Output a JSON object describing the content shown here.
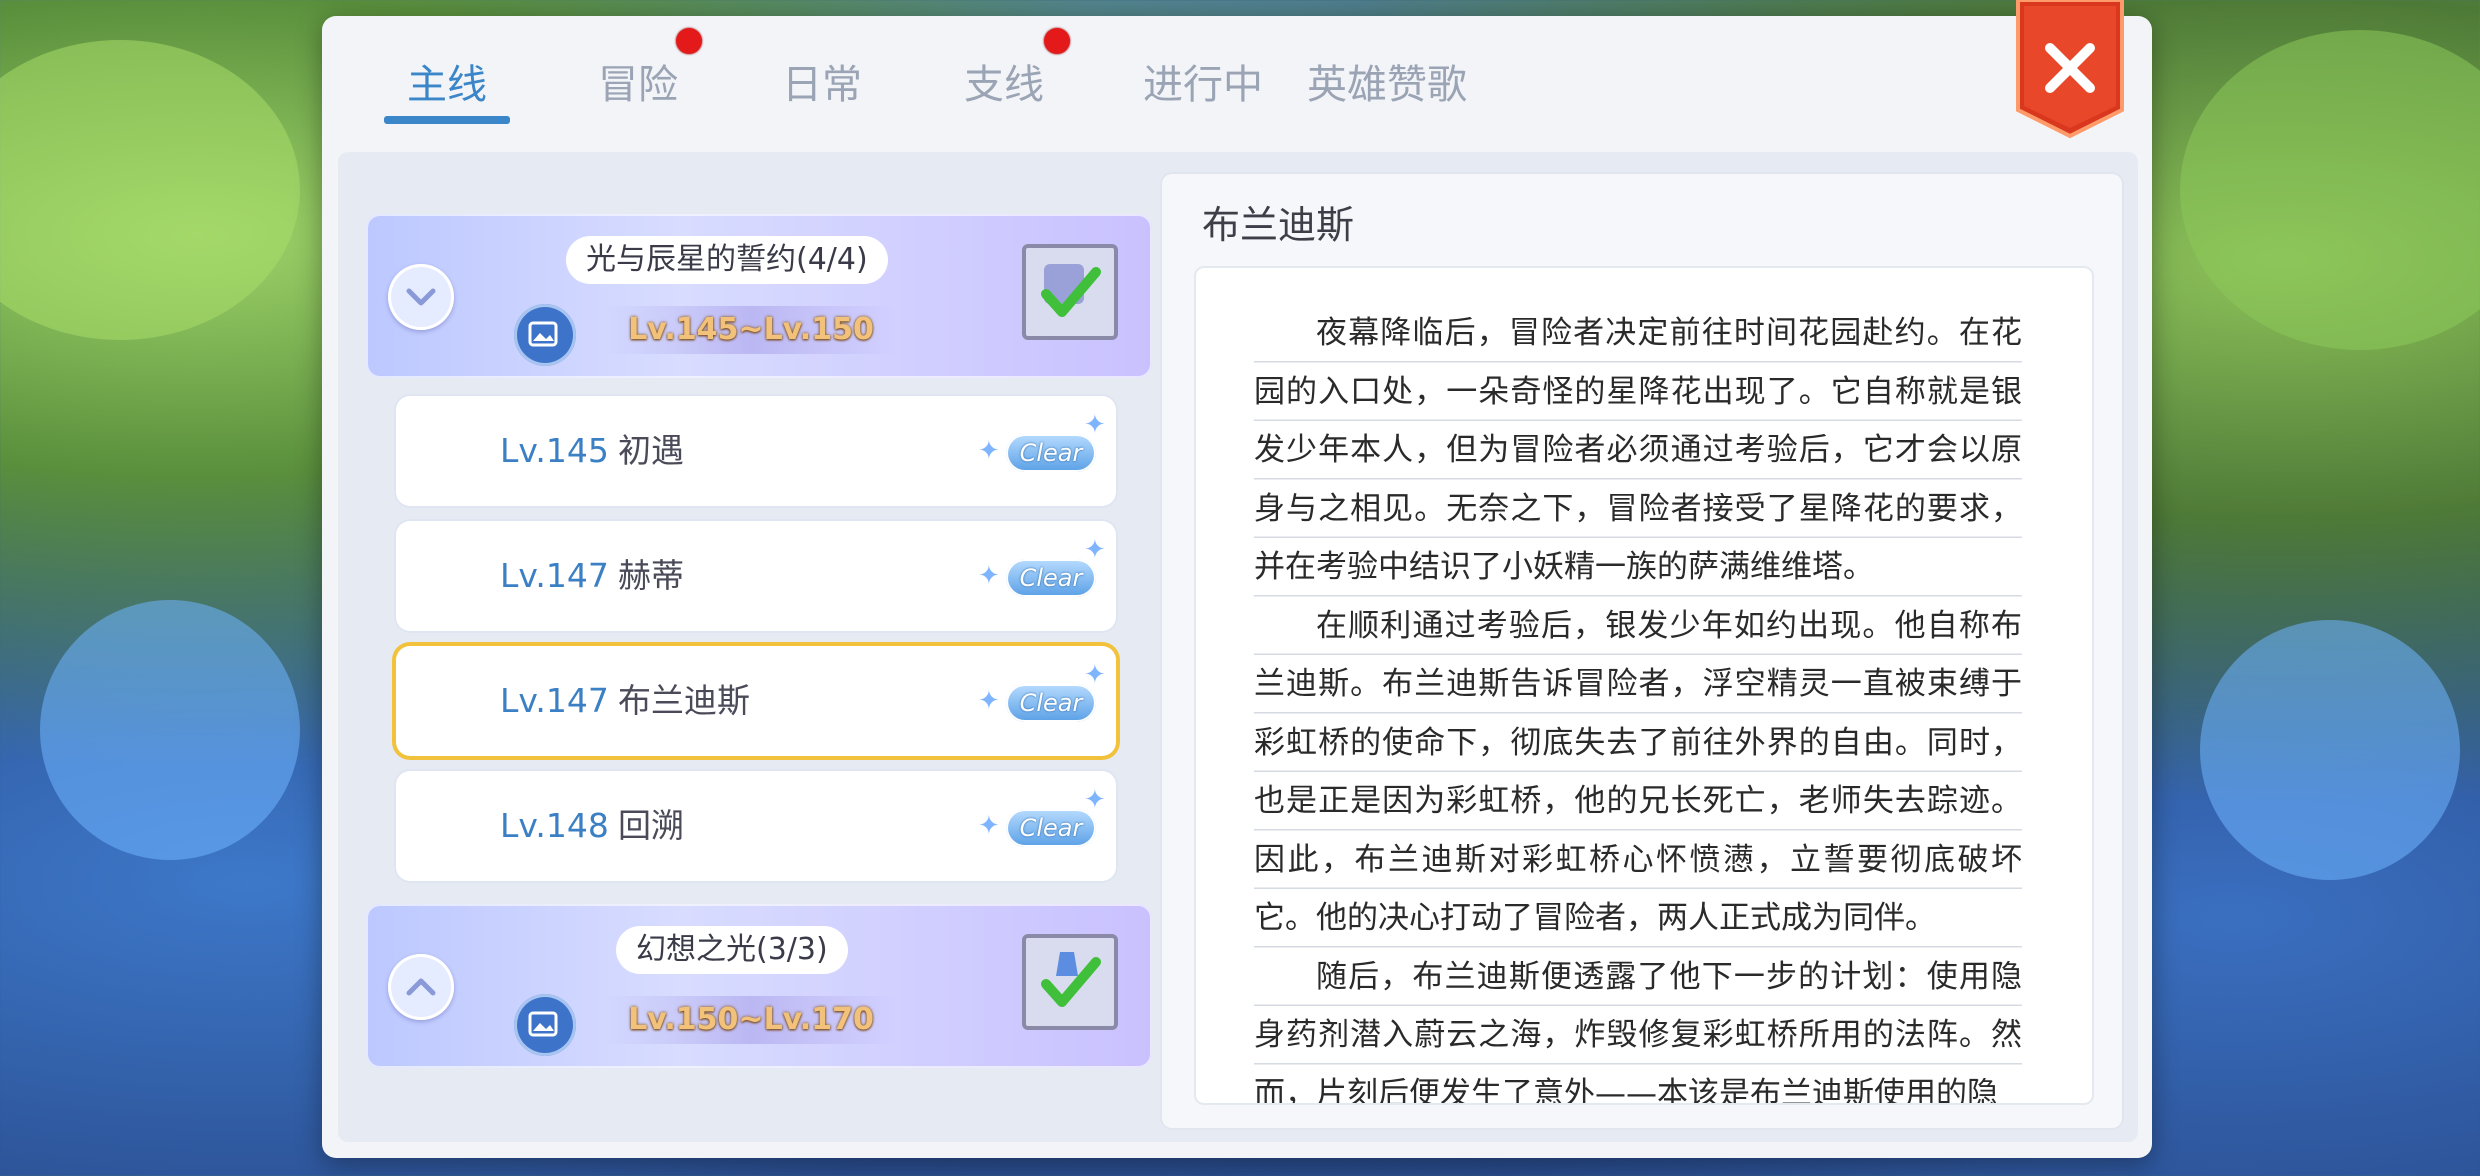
{
  "tabs": [
    {
      "label": "主线",
      "active": true,
      "dot": false
    },
    {
      "label": "冒险",
      "active": false,
      "dot": true
    },
    {
      "label": "日常",
      "active": false,
      "dot": false
    },
    {
      "label": "支线",
      "active": false,
      "dot": true
    },
    {
      "label": "进行中",
      "active": false,
      "dot": false
    },
    {
      "label": "英雄赞歌",
      "active": false,
      "dot": false
    }
  ],
  "close_icon": "close-x-icon",
  "groups": [
    {
      "title": "光与辰星的誓约(4/4)",
      "range": "Lv.145~Lv.150",
      "expanded": true
    },
    {
      "title": "幻想之光(3/3)",
      "range": "Lv.150~Lv.170",
      "expanded": false
    }
  ],
  "quests": [
    {
      "lv": "Lv.145",
      "name": "初遇",
      "badge": "Clear",
      "selected": false
    },
    {
      "lv": "Lv.147",
      "name": "赫蒂",
      "badge": "Clear",
      "selected": false
    },
    {
      "lv": "Lv.147",
      "name": "布兰迪斯",
      "badge": "Clear",
      "selected": true
    },
    {
      "lv": "Lv.148",
      "name": "回溯",
      "badge": "Clear",
      "selected": false
    }
  ],
  "detail": {
    "title": "布兰迪斯",
    "paragraphs": [
      "夜幕降临后，冒险者决定前往时间花园赴约。在花园的入口处，一朵奇怪的星降花出现了。它自称就是银发少年本人，但为冒险者必须通过考验后，它才会以原身与之相见。无奈之下，冒险者接受了星降花的要求，并在考验中结识了小妖精一族的萨满维维塔。",
      "在顺利通过考验后，银发少年如约出现。他自称布兰迪斯。布兰迪斯告诉冒险者，浮空精灵一直被束缚于彩虹桥的使命下，彻底失去了前往外界的自由。同时，也是正是因为彩虹桥，他的兄长死亡，老师失去踪迹。因此，布兰迪斯对彩虹桥心怀愤懑，立誓要彻底破坏它。他的决心打动了冒险者，两人正式成为同伴。",
      "随后，布兰迪斯便透露了他下一步的计划：使用隐身药剂潜入蔚云之海，炸毁修复彩虹桥所用的法阵。然而，片刻后便发生了意外——本该是布兰迪斯使用的隐"
    ]
  },
  "colors": {
    "accent": "#3a86c8",
    "selected_border": "#f3c23c",
    "red_dot": "#e41a1a",
    "level_text": "#3b7fc4"
  }
}
